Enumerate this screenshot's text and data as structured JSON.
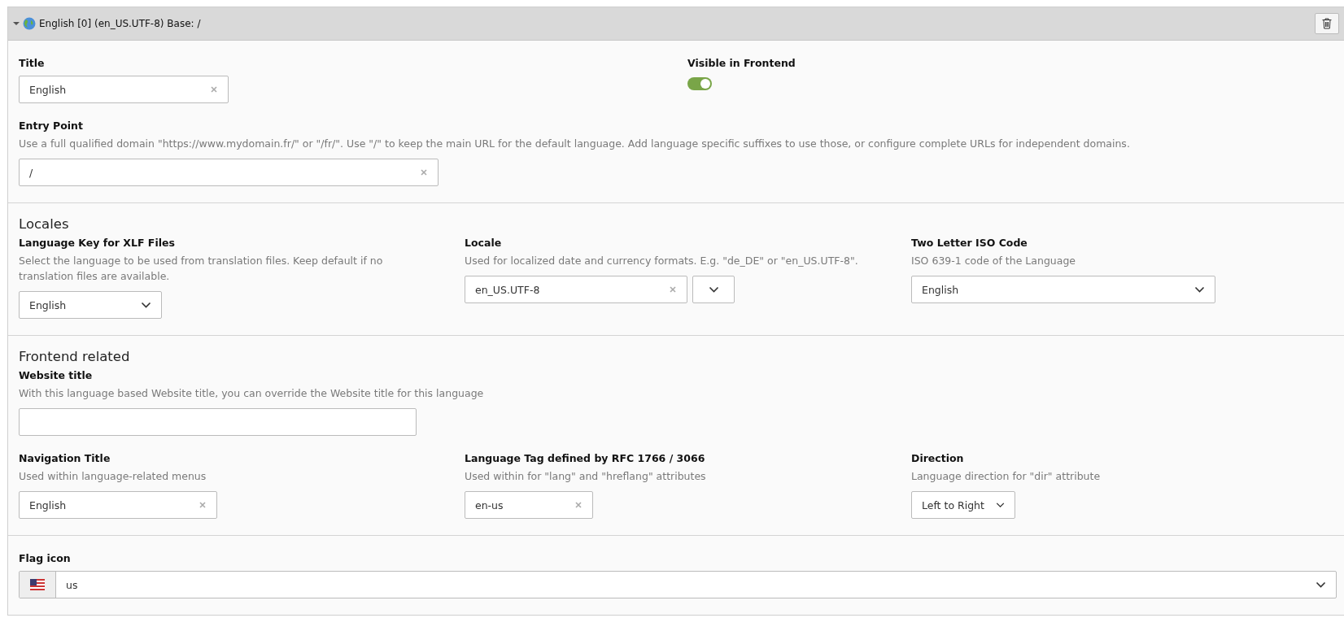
{
  "header": {
    "title": "English [0] (en_US.UTF-8) Base: /",
    "expanded": true
  },
  "sections": [
    {
      "rows": [
        [
          {
            "kind": "text",
            "label": "Title",
            "value": "English",
            "clearable": true
          },
          {
            "kind": "toggle",
            "label": "Visible in Frontend",
            "on": true
          }
        ],
        [
          {
            "kind": "text",
            "label": "Entry Point",
            "description": "Use a full qualified domain \"https://www.mydomain.fr/\" or \"/fr/\". Use \"/\" to keep the main URL for the default language. Add language specific suffixes to use those, or configure complete URLs for independent domains.",
            "value": "/",
            "clearable": true
          }
        ]
      ]
    },
    {
      "heading": "Locales",
      "rows": [
        [
          {
            "kind": "select",
            "label": "Language Key for XLF Files",
            "description": "Select the language to be used from translation files. Keep default if no translation files are available.",
            "value": "English"
          },
          {
            "kind": "combo",
            "label": "Locale",
            "description": "Used for localized date and currency formats. E.g. \"de_DE\" or \"en_US.UTF-8\".",
            "value": "en_US.UTF-8",
            "clearable": true
          },
          {
            "kind": "select",
            "label": "Two Letter ISO Code",
            "description": "ISO 639-1 code of the Language",
            "value": "English"
          }
        ]
      ]
    },
    {
      "heading": "Frontend related",
      "rows": [
        [
          {
            "kind": "text",
            "label": "Website title",
            "description": "With this language based Website title, you can override the Website title for this language",
            "clearable": false
          }
        ],
        [
          {
            "kind": "text",
            "label": "Navigation Title",
            "description": "Used within language-related menus",
            "value": "English",
            "clearable": true
          },
          {
            "kind": "text",
            "label": "Language Tag defined by RFC 1766 / 3066",
            "description": "Used within for \"lang\" and \"hreflang\" attributes",
            "value": "en-us",
            "clearable": true
          },
          {
            "kind": "select",
            "label": "Direction",
            "description": "Language direction for \"dir\" attribute",
            "value": "Left to Right"
          }
        ]
      ]
    },
    {
      "rows": [
        [
          {
            "kind": "flag_select",
            "label": "Flag icon",
            "value": "us"
          }
        ]
      ]
    }
  ]
}
